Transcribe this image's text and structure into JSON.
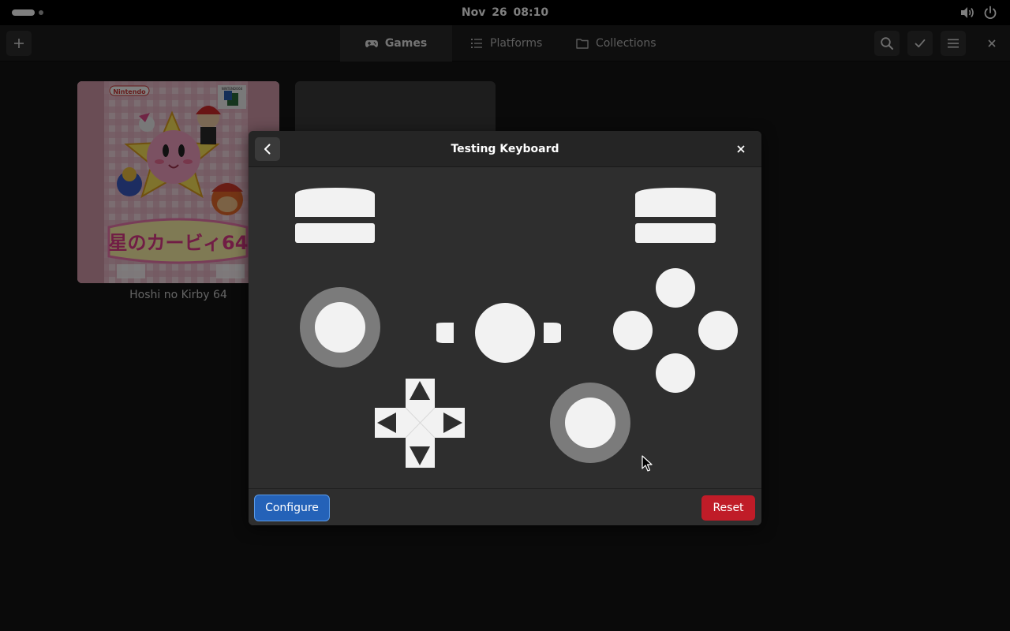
{
  "topbar": {
    "clock": "Nov 26  08:10",
    "volume_icon": "volume-icon",
    "power_icon": "power-icon"
  },
  "headerbar": {
    "tabs": [
      {
        "label": "Games",
        "icon": "gamepad-icon",
        "active": true
      },
      {
        "label": "Platforms",
        "icon": "list-icon",
        "active": false
      },
      {
        "label": "Collections",
        "icon": "folder-icon",
        "active": false
      }
    ]
  },
  "library": {
    "games": [
      {
        "title": "Hoshi no Kirby 64",
        "cover": {
          "brand": "Nintendo",
          "console": "NINTENDO64",
          "logo": "星のカービィ64"
        }
      }
    ]
  },
  "dialog": {
    "title": "Testing Keyboard",
    "configure_label": "Configure",
    "reset_label": "Reset"
  },
  "colors": {
    "accent_blue": "#2462b8",
    "destructive_red": "#c01c28",
    "dialog_bg": "#2e2e2e",
    "control_fill": "#f2f2f2"
  }
}
